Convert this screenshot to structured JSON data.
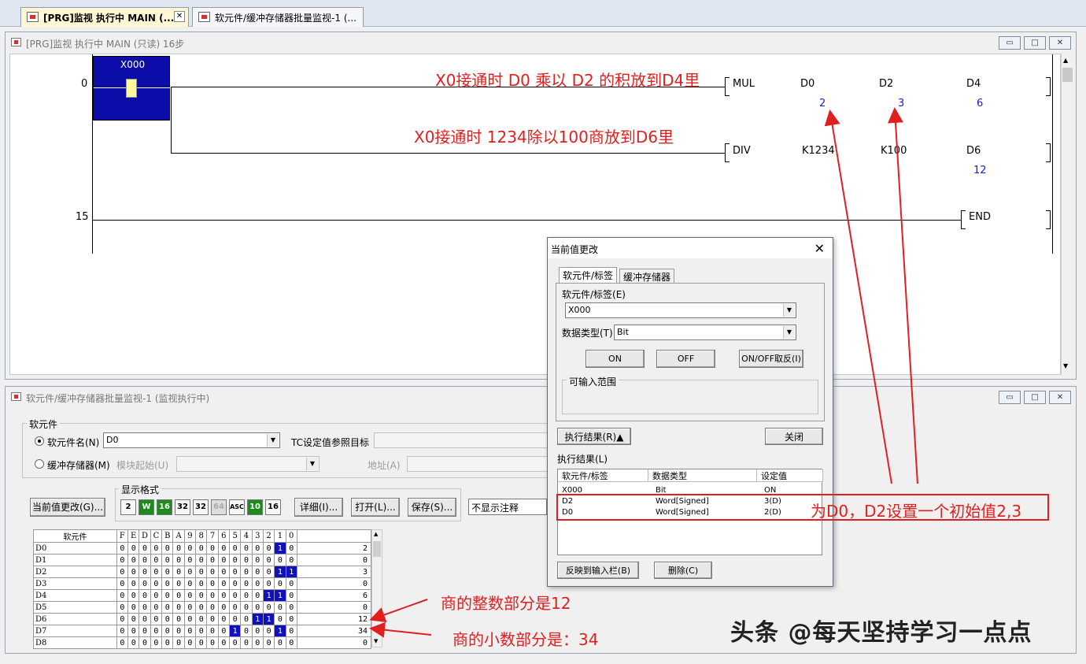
{
  "tabs": [
    {
      "label": "[PRG]监视 执行中 MAIN (..."
    },
    {
      "label": "软元件/缓冲存储器批量监视-1 (..."
    }
  ],
  "ladder_window": {
    "title": "[PRG]监视 执行中 MAIN (只读) 16步",
    "steps": [
      "0",
      "15"
    ],
    "contact": "X000",
    "rung1": {
      "op": "MUL",
      "a": "D0",
      "b": "D2",
      "c": "D4",
      "va": "2",
      "vb": "3",
      "vc": "6"
    },
    "rung2": {
      "op": "DIV",
      "a": "K1234",
      "b": "K100",
      "c": "D6",
      "vc": "12"
    },
    "end": "END",
    "annotations": {
      "mul": "X0接通时 D0 乘以 D2 的积放到D4里",
      "div": "X0接通时 1234除以100商放到D6里"
    }
  },
  "monitor_window": {
    "title": "软元件/缓冲存储器批量监视-1 (监视执行中)",
    "group_device": "软元件",
    "radio_device_label": "软元件名(N)",
    "device_value": "D0",
    "tc_label": "TC设定值参照目标",
    "radio_buffer_label": "缓冲存储器(M)",
    "module_start_label": "模块起始(U)",
    "address_label": "地址(A)",
    "display_format_label": "显示格式",
    "format_buttons": [
      "2",
      "W",
      "16",
      "32",
      "32",
      "64",
      "ASC",
      "10",
      "16"
    ],
    "btn_change": "当前值更改(G)...",
    "btn_detail": "详细(I)...",
    "btn_open": "打开(L)...",
    "btn_save": "保存(S)...",
    "comment_select": "不显示注释",
    "table_header_name": "软元件",
    "bit_headers": [
      "F",
      "E",
      "D",
      "C",
      "B",
      "A",
      "9",
      "8",
      "7",
      "6",
      "5",
      "4",
      "3",
      "2",
      "1",
      "0"
    ],
    "rows": [
      {
        "name": "D0",
        "bits": "0000000000000010",
        "value": "2"
      },
      {
        "name": "D1",
        "bits": "0000000000000000",
        "value": "0"
      },
      {
        "name": "D2",
        "bits": "0000000000000011",
        "value": "3"
      },
      {
        "name": "D3",
        "bits": "0000000000000000",
        "value": "0"
      },
      {
        "name": "D4",
        "bits": "0000000000000110",
        "value": "6"
      },
      {
        "name": "D5",
        "bits": "0000000000000000",
        "value": "0"
      },
      {
        "name": "D6",
        "bits": "0000000000001100",
        "value": "12"
      },
      {
        "name": "D7",
        "bits": "0000000000100010",
        "value": "34"
      },
      {
        "name": "D8",
        "bits": "0000000000000000",
        "value": "0"
      }
    ],
    "annotations": {
      "int": "商的整数部分是12",
      "frac": "商的小数部分是：34"
    }
  },
  "dialog": {
    "title": "当前值更改",
    "tab1": "软元件/标签",
    "tab2": "缓冲存储器",
    "device_label": "软元件/标签(E)",
    "device_value": "X000",
    "dtype_label": "数据类型(T)",
    "dtype_value": "Bit",
    "btn_on": "ON",
    "btn_off": "OFF",
    "btn_toggle": "ON/OFF取反(I)",
    "range_label": "可输入范围",
    "btn_result": "执行结果(R)▲",
    "btn_close": "关闭",
    "result_label": "执行结果(L)",
    "result_headers": [
      "软元件/标签",
      "数据类型",
      "设定值"
    ],
    "results": [
      {
        "dev": "X000",
        "type": "Bit",
        "val": "ON"
      },
      {
        "dev": "D2",
        "type": "Word[Signed]",
        "val": "3(D)"
      },
      {
        "dev": "D0",
        "type": "Word[Signed]",
        "val": "2(D)"
      }
    ],
    "btn_reflect": "反映到输入栏(B)",
    "btn_delete": "删除(C)",
    "annotation": "为D0，D2设置一个初始值2,3"
  },
  "watermark": "头条 @每天坚持学习一点点",
  "colors": {
    "annotation": "#e02020",
    "bit_on": "#1010c0",
    "current_value": "#1a1ad0",
    "contact_bg": "#0c0ca8"
  }
}
